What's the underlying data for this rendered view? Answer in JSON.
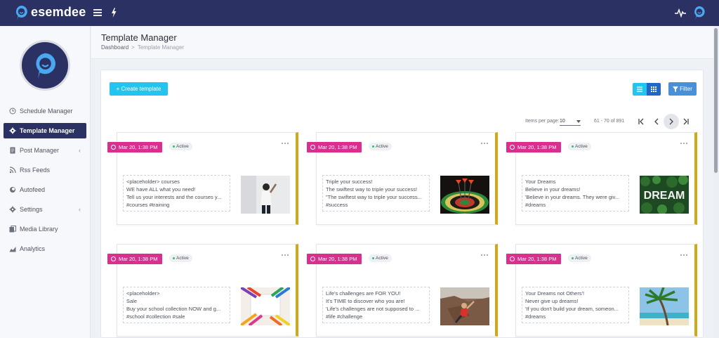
{
  "app": {
    "brand": "esemdee"
  },
  "sidebar": {
    "items": [
      {
        "label": "Schedule Manager",
        "icon": "clock-icon",
        "active": false,
        "has_submenu": false
      },
      {
        "label": "Template Manager",
        "icon": "gear-icon",
        "active": true,
        "has_submenu": false
      },
      {
        "label": "Post Manager",
        "icon": "document-icon",
        "active": false,
        "has_submenu": true
      },
      {
        "label": "Rss Feeds",
        "icon": "rss-icon",
        "active": false,
        "has_submenu": false
      },
      {
        "label": "Autofeed",
        "icon": "autofeed-icon",
        "active": false,
        "has_submenu": false
      },
      {
        "label": "Settings",
        "icon": "gear-icon",
        "active": false,
        "has_submenu": true
      },
      {
        "label": "Media Library",
        "icon": "media-icon",
        "active": false,
        "has_submenu": false
      },
      {
        "label": "Analytics",
        "icon": "chart-icon",
        "active": false,
        "has_submenu": false
      }
    ]
  },
  "header": {
    "title": "Template Manager",
    "breadcrumb": {
      "root": "Dashboard",
      "separator": ">",
      "current": "Template Manager"
    }
  },
  "toolbar": {
    "create_label": "+ Create template",
    "filter_label": "Filter"
  },
  "pagination": {
    "items_per_page_label": "Items per page:",
    "items_per_page": "10",
    "range": "61 - 70 of 891"
  },
  "colors": {
    "brand": "#2b3163",
    "accent": "#23c4ee",
    "badge": "#d9308f",
    "card_border": "#d2a818"
  },
  "cards": [
    {
      "date": "Mar 20, 1:38 PM",
      "status": "Active",
      "lines": [
        "<placeholder> courses",
        "WE have ALL what you need!",
        "Tell us your interests and the courses y...",
        "#courses #training"
      ],
      "image": "woman-writing-on-wall"
    },
    {
      "date": "Mar 20, 1:38 PM",
      "status": "Active",
      "lines": [
        "Triple your success!",
        "The swiftest way to triple your success!",
        "\"The swiftest way to triple your success...",
        "#success"
      ],
      "image": "darts-on-dartboard"
    },
    {
      "date": "Mar 20, 1:38 PM",
      "status": "Active",
      "lines": [
        "Your Dreams",
        "Believe in your dreams!",
        "'Believe in your dreams. They were giv...",
        "#dreams"
      ],
      "image": "dream-leaves-sign",
      "image_text": "DREAM"
    },
    {
      "date": "Mar 20, 1:38 PM",
      "status": "Active",
      "lines": [
        "<placeholder>",
        "Sale",
        "Buy your school collection NOW and g...",
        "#school #collection #sale"
      ],
      "image": "colored-pencils"
    },
    {
      "date": "Mar 20, 1:38 PM",
      "status": "Active",
      "lines": [
        "Life's challenges are FOR YOU!",
        "It's TIME to discover who you are!",
        "'Life's challenges are not supposed to ...",
        "#life #challenge"
      ],
      "image": "rock-climber"
    },
    {
      "date": "Mar 20, 1:38 PM",
      "status": "Active",
      "lines": [
        "Your Dreams not Others'!",
        "Never give up dreams!",
        "'If you don't build your dream, someon...",
        "#dreams"
      ],
      "image": "palm-tree-beach"
    }
  ]
}
